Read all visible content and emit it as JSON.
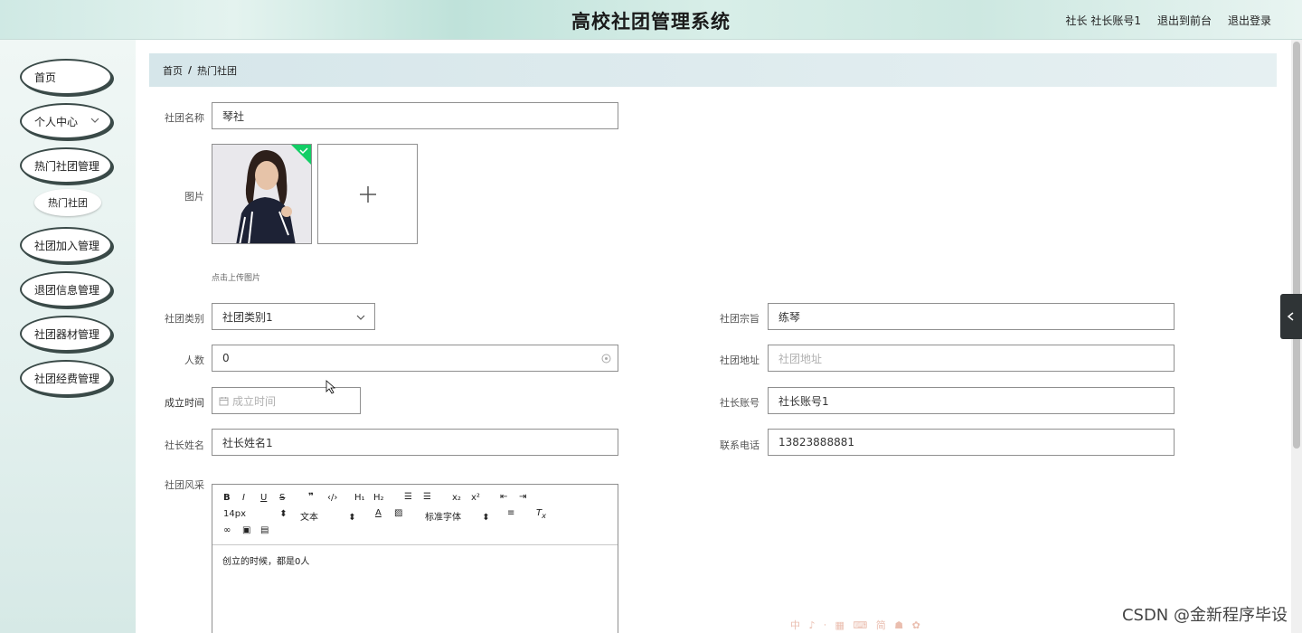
{
  "header": {
    "title": "高校社团管理系统",
    "user": "社长 社长账号1",
    "exit_front": "退出到前台",
    "logout": "退出登录"
  },
  "sidebar": {
    "items": [
      {
        "label": "首页"
      },
      {
        "label": "个人中心"
      },
      {
        "label": "热门社团管理"
      },
      {
        "label": "社团加入管理"
      },
      {
        "label": "退团信息管理"
      },
      {
        "label": "社团器材管理"
      },
      {
        "label": "社团经费管理"
      }
    ],
    "sub_item": "热门社团"
  },
  "breadcrumb": {
    "home": "首页",
    "sep": "/",
    "current": "热门社团"
  },
  "form": {
    "name_label": "社团名称",
    "name_value": "琴社",
    "image_label": "图片",
    "upload_hint": "点击上传图片",
    "category_label": "社团类别",
    "category_value": "社团类别1",
    "purpose_label": "社团宗旨",
    "purpose_value": "练琴",
    "count_label": "人数",
    "count_value": "0",
    "address_label": "社团地址",
    "address_placeholder": "社团地址",
    "date_label": "成立时间",
    "date_placeholder": "成立时间",
    "account_label": "社长账号",
    "account_value": "社长账号1",
    "leader_label": "社长姓名",
    "leader_value": "社长姓名1",
    "phone_label": "联系电话",
    "phone_value": "13823888881",
    "style_label": "社团风采"
  },
  "editor": {
    "font_size": "14px",
    "text_type": "文本",
    "font_family": "标准字体",
    "content": "创立的时候，都是0人"
  },
  "watermark": "CSDN @金新程序毕设",
  "ime": "中 ♪ ⸱ ▦ ⌨ 简 ☗ ✿"
}
